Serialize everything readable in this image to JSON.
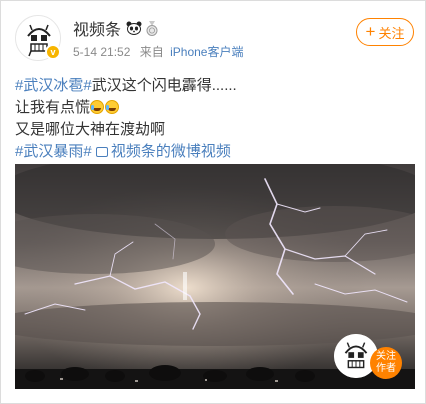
{
  "header": {
    "username": "视频条",
    "user_icons": [
      "panda-emoji-icon",
      "medal-icon"
    ],
    "timestamp": "5-14 21:52",
    "source_prefix": "来自",
    "source": "iPhone客户端",
    "follow_label": "关注",
    "follow_icon": "+"
  },
  "post": {
    "hashtag_1": "#武汉冰雹#",
    "line1_text": "武汉这个闪电霹得......",
    "line2_text": "让我有点慌",
    "line2_emojis": [
      "laugh-cry-emoji",
      "laugh-cry-emoji"
    ],
    "line3_text": "又是哪位大神在渡劫啊",
    "hashtag_2": "#武汉暴雨#",
    "video_link": "视频条的微博视频"
  },
  "video": {
    "watermark_follow": "关注",
    "watermark_follow_2": "作者"
  },
  "colors": {
    "link": "#4a7fbd",
    "accent": "#ff8200",
    "meta": "#8a8a8a",
    "text": "#333333",
    "verified": "#f7b500"
  }
}
